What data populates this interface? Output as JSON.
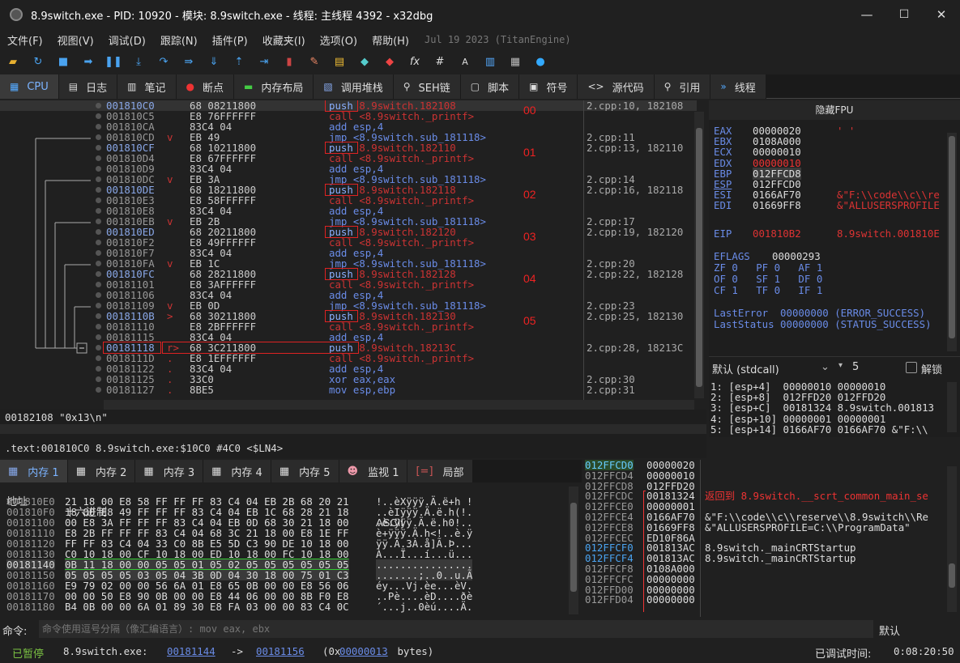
{
  "window": {
    "title": "8.9switch.exe - PID: 10920 - 模块: 8.9switch.exe - 线程: 主线程 4392 - x32dbg",
    "min": "—",
    "max": "☐",
    "close": "✕"
  },
  "menu": [
    "文件(F)",
    "视图(V)",
    "调试(D)",
    "跟踪(N)",
    "插件(P)",
    "收藏夹(I)",
    "选项(O)",
    "帮助(H)"
  ],
  "menu_extra": "Jul 19 2023 (TitanEngine)",
  "tabs": [
    "CPU",
    "日志",
    "笔记",
    "断点",
    "内存布局",
    "调用堆栈",
    "SEH链",
    "脚本",
    "符号",
    "源代码",
    "引用",
    "线程"
  ],
  "disasm": [
    {
      "addr": "001810C0",
      "mark": "",
      "bytes": "68 08211800",
      "op": "push",
      "args": "8.9switch.182108",
      "cmt": "2.cpp:10, 182108",
      "hl": true
    },
    {
      "addr": "001810C5",
      "mark": "",
      "bytes": "E8 76FFFFFF",
      "op": "call",
      "args": "<8.9switch._printf>",
      "cmt": ""
    },
    {
      "addr": "001810CA",
      "mark": "",
      "bytes": "83C4 04",
      "op": "add",
      "args": "esp,4",
      "cmt": ""
    },
    {
      "addr": "001810CD",
      "mark": "v",
      "bytes": "EB 49",
      "op": "jmp",
      "args": "<8.9switch.sub_181118>",
      "cmt": "2.cpp:11"
    },
    {
      "addr": "001810CF",
      "mark": "",
      "bytes": "68 10211800",
      "op": "push",
      "args": "8.9switch.182110",
      "cmt": "2.cpp:13, 182110",
      "hl": true
    },
    {
      "addr": "001810D4",
      "mark": "",
      "bytes": "E8 67FFFFFF",
      "op": "call",
      "args": "<8.9switch._printf>",
      "cmt": ""
    },
    {
      "addr": "001810D9",
      "mark": "",
      "bytes": "83C4 04",
      "op": "add",
      "args": "esp,4",
      "cmt": ""
    },
    {
      "addr": "001810DC",
      "mark": "v",
      "bytes": "EB 3A",
      "op": "jmp",
      "args": "<8.9switch.sub_181118>",
      "cmt": "2.cpp:14"
    },
    {
      "addr": "001810DE",
      "mark": "",
      "bytes": "68 18211800",
      "op": "push",
      "args": "8.9switch.182118",
      "cmt": "2.cpp:16, 182118",
      "hl": true
    },
    {
      "addr": "001810E3",
      "mark": "",
      "bytes": "E8 58FFFFFF",
      "op": "call",
      "args": "<8.9switch._printf>",
      "cmt": ""
    },
    {
      "addr": "001810E8",
      "mark": "",
      "bytes": "83C4 04",
      "op": "add",
      "args": "esp,4",
      "cmt": ""
    },
    {
      "addr": "001810EB",
      "mark": "v",
      "bytes": "EB 2B",
      "op": "jmp",
      "args": "<8.9switch.sub_181118>",
      "cmt": "2.cpp:17"
    },
    {
      "addr": "001810ED",
      "mark": "",
      "bytes": "68 20211800",
      "op": "push",
      "args": "8.9switch.182120",
      "cmt": "2.cpp:19, 182120",
      "hl": true
    },
    {
      "addr": "001810F2",
      "mark": "",
      "bytes": "E8 49FFFFFF",
      "op": "call",
      "args": "<8.9switch._printf>",
      "cmt": ""
    },
    {
      "addr": "001810F7",
      "mark": "",
      "bytes": "83C4 04",
      "op": "add",
      "args": "esp,4",
      "cmt": ""
    },
    {
      "addr": "001810FA",
      "mark": "v",
      "bytes": "EB 1C",
      "op": "jmp",
      "args": "<8.9switch.sub_181118>",
      "cmt": "2.cpp:20"
    },
    {
      "addr": "001810FC",
      "mark": "",
      "bytes": "68 28211800",
      "op": "push",
      "args": "8.9switch.182128",
      "cmt": "2.cpp:22, 182128",
      "hl": true
    },
    {
      "addr": "00181101",
      "mark": "",
      "bytes": "E8 3AFFFFFF",
      "op": "call",
      "args": "<8.9switch._printf>",
      "cmt": ""
    },
    {
      "addr": "00181106",
      "mark": "",
      "bytes": "83C4 04",
      "op": "add",
      "args": "esp,4",
      "cmt": ""
    },
    {
      "addr": "00181109",
      "mark": "v",
      "bytes": "EB 0D",
      "op": "jmp",
      "args": "<8.9switch.sub_181118>",
      "cmt": "2.cpp:23"
    },
    {
      "addr": "0018110B",
      "mark": ">",
      "bytes": "68 30211800",
      "op": "push",
      "args": "8.9switch.182130",
      "cmt": "2.cpp:25, 182130",
      "hl": true
    },
    {
      "addr": "00181110",
      "mark": "",
      "bytes": "E8 2BFFFFFF",
      "op": "call",
      "args": "<8.9switch._printf>",
      "cmt": ""
    },
    {
      "addr": "00181115",
      "mark": "",
      "bytes": "83C4 04",
      "op": "add",
      "args": "esp,4",
      "cmt": ""
    },
    {
      "addr": "00181118",
      "mark": "r>",
      "bytes": "68 3C211800",
      "op": "push",
      "args": "8.9switch.18213C",
      "cmt": "2.cpp:28, 18213C",
      "hl": true
    },
    {
      "addr": "0018111D",
      "mark": ".",
      "bytes": "E8 1EFFFFFF",
      "op": "call",
      "args": "<8.9switch._printf>",
      "cmt": ""
    },
    {
      "addr": "00181122",
      "mark": ".",
      "bytes": "83C4 04",
      "op": "add",
      "args": "esp,4",
      "cmt": ""
    },
    {
      "addr": "00181125",
      "mark": ".",
      "bytes": "33C0",
      "op": "xor",
      "args": "eax,eax",
      "cmt": "2.cpp:30"
    },
    {
      "addr": "00181127",
      "mark": ".",
      "bytes": "8BE5",
      "op": "mov",
      "args": "esp,ebp",
      "cmt": "2.cpp:31"
    }
  ],
  "annotations": [
    "00",
    "01",
    "02",
    "03",
    "04",
    "05"
  ],
  "fpu_header": "隐藏FPU",
  "registers": [
    {
      "n": "EAX",
      "v": "00000020",
      "c": "' '"
    },
    {
      "n": "EBX",
      "v": "0108A000",
      "c": ""
    },
    {
      "n": "ECX",
      "v": "00000010",
      "c": ""
    },
    {
      "n": "EDX",
      "v": "00000010",
      "c": ""
    },
    {
      "n": "EBP",
      "v": "012FFCD8",
      "c": ""
    },
    {
      "n": "ESP",
      "v": "012FFCD0",
      "c": ""
    },
    {
      "n": "ESI",
      "v": "0166AF70",
      "c": "&\"F:\\\\code\\\\c\\\\re"
    },
    {
      "n": "EDI",
      "v": "01669FF8",
      "c": "&\"ALLUSERSPROFILE"
    }
  ],
  "eip": {
    "n": "EIP",
    "v": "001810B2",
    "c": "8.9switch.001810E"
  },
  "eflags": {
    "n": "EFLAGS",
    "v": "00000293"
  },
  "flags": [
    "ZF 0   PF 0   AF 1",
    "OF 0   SF 1   DF 0",
    "CF 1   TF 0   IF 1"
  ],
  "lasterror": "LastError  00000000 (ERROR_SUCCESS)",
  "laststatus": "LastStatus 00000000 (STATUS_SUCCESS)",
  "callconv": "默认 (stdcall)",
  "argcount": "5",
  "unlock": "解锁",
  "args": [
    "1: [esp+4]  00000010 00000010",
    "2: [esp+8]  012FFD20 012FFD20",
    "3: [esp+C]  00181324 8.9switch.001813",
    "4: [esp+10] 00000001 00000001",
    "5: [esp+14] 0166AF70 0166AF70 &\"F:\\\\"
  ],
  "info_line": "00182108 \"0x13\\n\"",
  "section_line": ".text:001810C0 8.9switch.exe:$10C0 #4C0 <$LN4>",
  "memtabs": [
    "内存 1",
    "内存 2",
    "内存 3",
    "内存 4",
    "内存 5",
    "监视 1",
    "局部"
  ],
  "dump_headers": [
    "地址",
    "十六进制",
    "ASCII"
  ],
  "dump": [
    {
      "a": "001810E0",
      "h": "21 18 00 E8 58 FF FF FF 83 C4 04 EB 2B 68 20 21",
      "s": "!..èXÿÿÿ.Ä.ë+h !"
    },
    {
      "a": "001810F0",
      "h": "18 00 E8 49 FF FF FF 83 C4 04 EB 1C 68 28 21 18",
      "s": "..èIÿÿÿ.Ä.ë.h(!."
    },
    {
      "a": "00181100",
      "h": "00 E8 3A FF FF FF 83 C4 04 EB 0D 68 30 21 18 00",
      "s": ".è:ÿÿÿ.Ä.ë.h0!.."
    },
    {
      "a": "00181110",
      "h": "E8 2B FF FF FF 83 C4 04 68 3C 21 18 00 E8 1E FF",
      "s": "è+ÿÿÿ.Ä.h<!..è.ÿ"
    },
    {
      "a": "00181120",
      "h": "FF FF 83 C4 04 33 C0 8B E5 5D C3 90 DE 10 18 00",
      "s": "ÿÿ.Ä.3À.å]Ã.Þ..."
    },
    {
      "a": "00181130",
      "h": "C0 10 18 00 CF 10 18 00 ED 10 18 00 FC 10 18 00",
      "s": "À...Ï...í...ü..."
    },
    {
      "a": "00181140",
      "h": "0B 11 18 00 00 05 05 01 05 02 05 05 05 05 05 05",
      "s": "................"
    },
    {
      "a": "00181150",
      "h": "05 05 05 05 03 05 04 3B 0D 04 30 18 00 75 01 C3",
      "s": ".......;..0..u.Ã"
    },
    {
      "a": "00181160",
      "h": "E9 79 02 00 00 56 6A 01 E8 65 0B 00 00 E8 56 06",
      "s": "éy...Vj.èe...èV."
    },
    {
      "a": "00181170",
      "h": "00 00 50 E8 90 0B 00 00 E8 44 06 00 00 8B F0 E8",
      "s": "..Pè....èD....ðè"
    },
    {
      "a": "00181180",
      "h": "B4 0B 00 00 6A 01 89 30 E8 FA 03 00 00 83 C4 0C",
      "s": "´...j..0èú....Ä."
    }
  ],
  "stack": [
    {
      "a": "012FFCD0",
      "v": "00000020",
      "c": "",
      "cur": true
    },
    {
      "a": "012FFCD4",
      "v": "00000010",
      "c": ""
    },
    {
      "a": "012FFCD8",
      "v": "012FFD20",
      "c": ""
    },
    {
      "a": "012FFCDC",
      "v": "00181324",
      "c": "返回到 8.9switch.__scrt_common_main_se"
    },
    {
      "a": "012FFCE0",
      "v": "00000001",
      "c": ""
    },
    {
      "a": "012FFCE4",
      "v": "0166AF70",
      "c": "&\"F:\\\\code\\\\c\\\\reserve\\\\8.9switch\\\\Re"
    },
    {
      "a": "012FFCE8",
      "v": "01669FF8",
      "c": "&\"ALLUSERSPROFILE=C:\\\\ProgramData\""
    },
    {
      "a": "012FFCEC",
      "v": "ED10F86A",
      "c": ""
    },
    {
      "a": "012FFCF0",
      "v": "001813AC",
      "c": "8.9switch._mainCRTStartup"
    },
    {
      "a": "012FFCF4",
      "v": "001813AC",
      "c": "8.9switch._mainCRTStartup"
    },
    {
      "a": "012FFCF8",
      "v": "0108A000",
      "c": ""
    },
    {
      "a": "012FFCFC",
      "v": "00000000",
      "c": ""
    },
    {
      "a": "012FFD00",
      "v": "00000000",
      "c": ""
    },
    {
      "a": "012FFD04",
      "v": "00000000",
      "c": ""
    }
  ],
  "cmd": {
    "label": "命令:",
    "placeholder": "命令使用逗号分隔（像汇编语言）: mov eax, ebx",
    "default": "默认"
  },
  "status": {
    "state": "已暂停",
    "module": "8.9switch.exe:",
    "from": "00181144",
    "arrow": "->",
    "to": "00181156",
    "size_open": "(0x",
    "size": "00000013",
    "size_close": " bytes)",
    "time_label": "已调试时间:",
    "time": "0:08:20:50"
  }
}
